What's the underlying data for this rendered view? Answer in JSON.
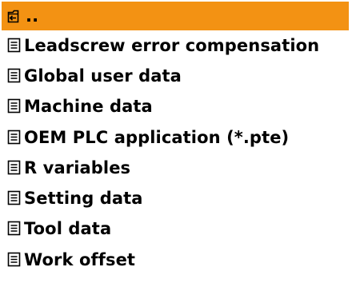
{
  "file_list": {
    "selected_color": "#f39213",
    "items": [
      {
        "label": "..",
        "icon": "folder-up-icon",
        "selected": true
      },
      {
        "label": "Leadscrew error compensation",
        "icon": "document-icon",
        "selected": false
      },
      {
        "label": "Global user data",
        "icon": "document-icon",
        "selected": false
      },
      {
        "label": "Machine data",
        "icon": "document-icon",
        "selected": false
      },
      {
        "label": "OEM PLC application (*.pte)",
        "icon": "document-icon",
        "selected": false
      },
      {
        "label": "R variables",
        "icon": "document-icon",
        "selected": false
      },
      {
        "label": "Setting data",
        "icon": "document-icon",
        "selected": false
      },
      {
        "label": "Tool data",
        "icon": "document-icon",
        "selected": false
      },
      {
        "label": "Work offset",
        "icon": "document-icon",
        "selected": false
      }
    ]
  }
}
